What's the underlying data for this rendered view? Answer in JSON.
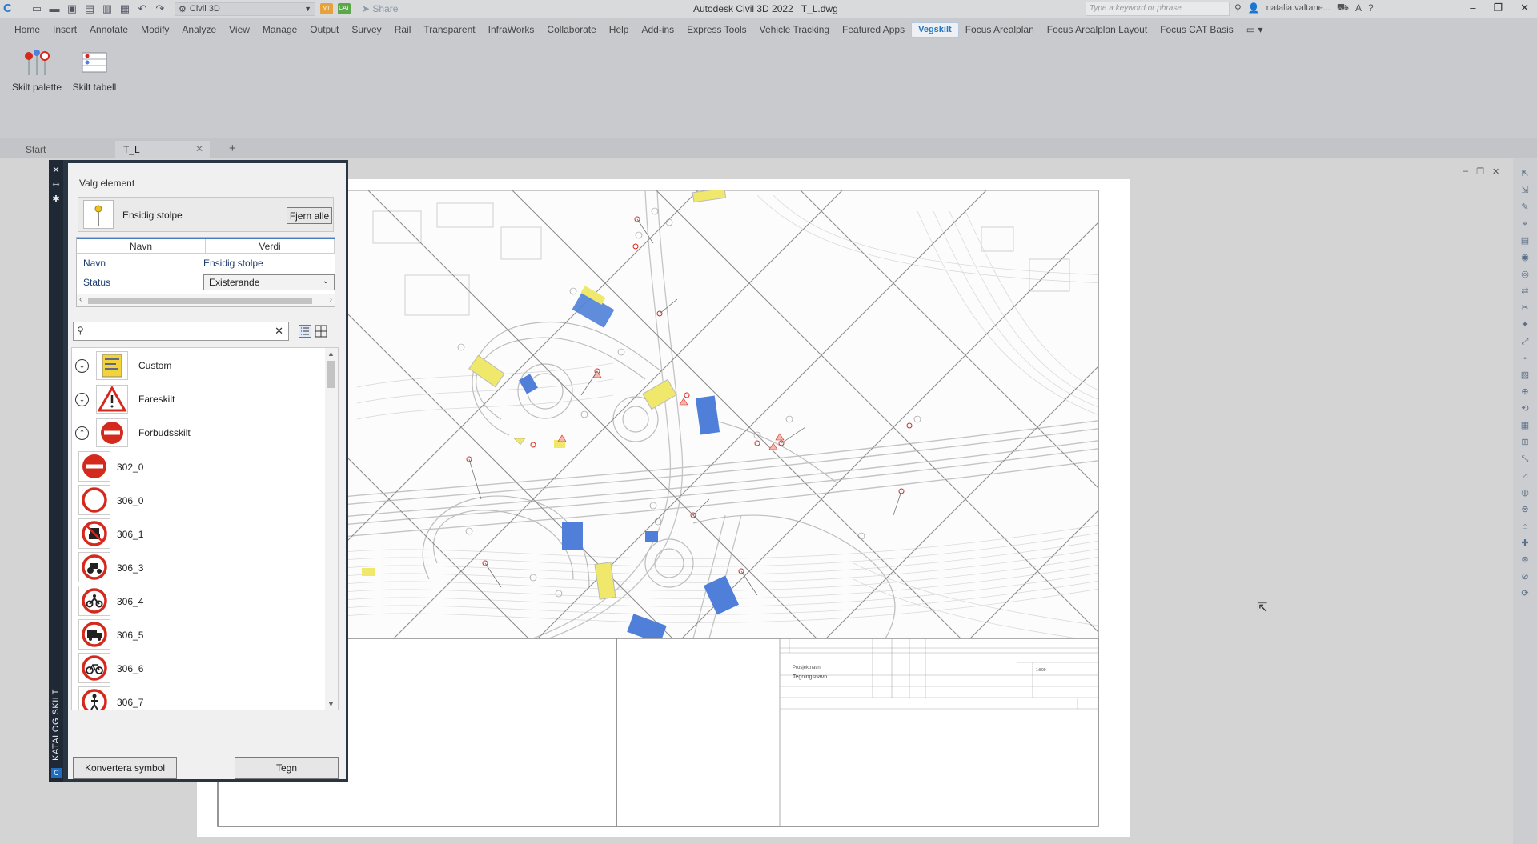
{
  "titlebar": {
    "workspace": "Civil 3D",
    "share": "Share",
    "app_name": "Autodesk Civil 3D 2022",
    "file_name": "T_L.dwg",
    "search_placeholder": "Type a keyword or phrase",
    "user": "natalia.valtane..."
  },
  "ribbon": {
    "tabs": [
      "Home",
      "Insert",
      "Annotate",
      "Modify",
      "Analyze",
      "View",
      "Manage",
      "Output",
      "Survey",
      "Rail",
      "Transparent",
      "InfraWorks",
      "Collaborate",
      "Help",
      "Add-ins",
      "Express Tools",
      "Vehicle Tracking",
      "Featured Apps",
      "Vegskilt",
      "Focus Arealplan",
      "Focus Arealplan Layout",
      "Focus CAT Basis"
    ],
    "active_tab": "Vegskilt",
    "buttons": {
      "skilt_palette": "Skilt palette",
      "skilt_tabell": "Skilt tabell"
    }
  },
  "doc_tabs": {
    "start": "Start",
    "active": "T_L"
  },
  "palette": {
    "vertical_title": "KATALOG SKILT",
    "header": "Valg element",
    "selected_label": "Ensidig stolpe",
    "remove_all": "Fjern alle",
    "columns": {
      "name": "Navn",
      "value": "Verdi"
    },
    "rows": {
      "name_key": "Navn",
      "name_value": "Ensidig stolpe",
      "status_key": "Status",
      "status_value": "Existerande"
    },
    "search_value": "",
    "groups": {
      "custom": "Custom",
      "fareskilt": "Fareskilt",
      "forbudsskilt": "Forbudsskilt"
    },
    "items": {
      "i0": "302_0",
      "i1": "306_0",
      "i2": "306_1",
      "i3": "306_3",
      "i4": "306_4",
      "i5": "306_5",
      "i6": "306_6",
      "i7": "306_7"
    },
    "convert_btn": "Konvertera symbol",
    "draw_btn": "Tegn"
  },
  "drawing": {
    "title_block": {
      "project": "Prosjektnavn",
      "drawing_name": "Tegningsnavn",
      "scale": "1:500"
    }
  },
  "colors": {
    "accent": "#2277c8",
    "palette_dark": "#2a3544",
    "sign_red": "#d42a1e",
    "sign_blue": "#4f7fd8",
    "sign_yellow": "#f0e86a"
  }
}
